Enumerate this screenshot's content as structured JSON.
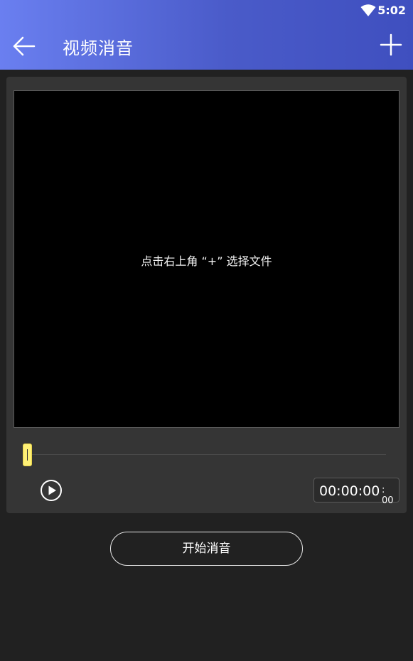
{
  "status_bar": {
    "time": "5:02",
    "wifi_icon": "wifi-icon"
  },
  "app_bar": {
    "title": "视频消音",
    "back_icon": "arrow-left-icon",
    "add_icon": "plus-icon"
  },
  "preview": {
    "hint": "点击右上角 “+” 选择文件"
  },
  "player": {
    "play_icon": "play-icon",
    "time_main": "00:00:00",
    "time_ms": ": 00",
    "progress": 0
  },
  "actions": {
    "start_label": "开始消音"
  },
  "colors": {
    "appbar_start": "#6a7ff0",
    "appbar_end": "#3f4fbf",
    "background": "#212121",
    "panel": "#353535",
    "handle": "#fff176"
  }
}
